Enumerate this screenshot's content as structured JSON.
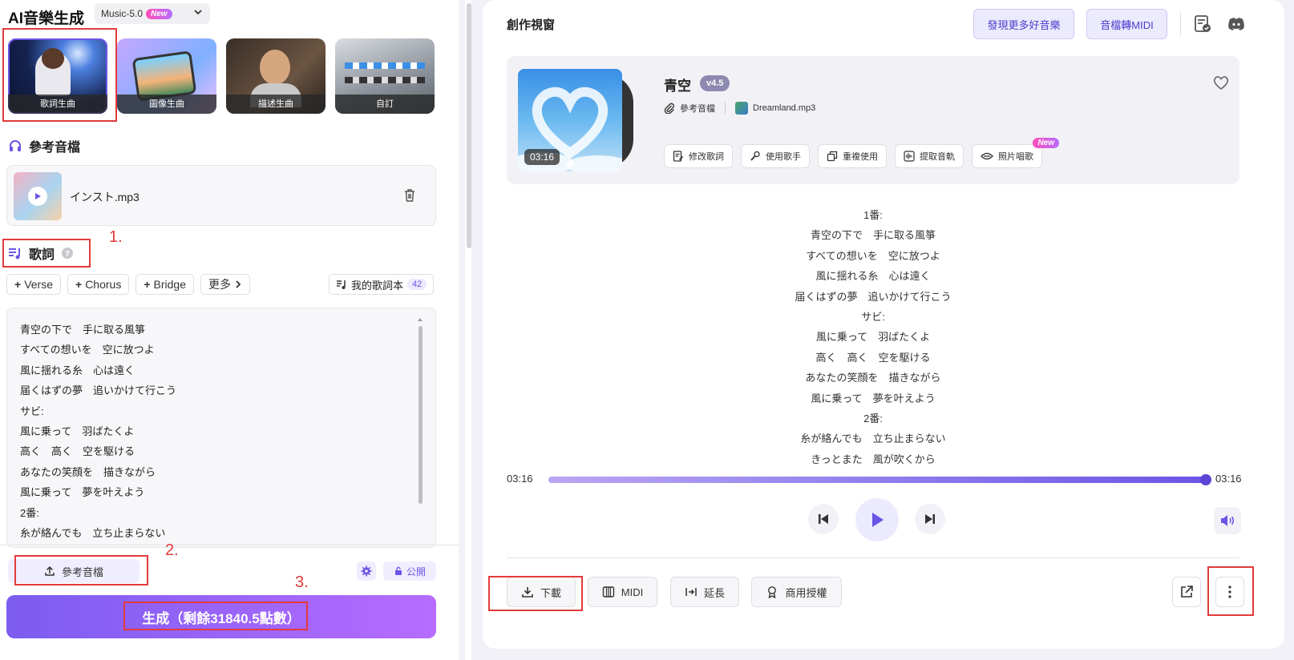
{
  "app": {
    "title": "AI音樂生成",
    "model": "Music-5.0",
    "model_badge": "New"
  },
  "modes": [
    {
      "label": "歌詞生曲",
      "active": true
    },
    {
      "label": "圖像生曲",
      "active": false
    },
    {
      "label": "描述生曲",
      "active": false
    },
    {
      "label": "自訂",
      "active": false
    }
  ],
  "reference": {
    "title": "參考音檔",
    "file_name": "インスト.mp3"
  },
  "lyrics_section": {
    "title": "歌詞",
    "tags": [
      "Verse",
      "Chorus",
      "Bridge"
    ],
    "more_label": "更多",
    "lyric_book_label": "我的歌詞本",
    "lyric_book_count": "42",
    "lines": [
      " 青空の下で　手に取る風箏",
      "すべての想いを　空に放つよ",
      "風に揺れる糸　心は遠く",
      "届くはずの夢　追いかけて行こう",
      "サビ:",
      "風に乗って　羽ばたくよ",
      "高く　高く　空を駆ける",
      "あなたの笑顔を　描きながら",
      "風に乗って　夢を叶えよう",
      "2番:",
      "糸が絡んでも　立ち止まらない"
    ]
  },
  "bottom": {
    "upload_label": "參考音檔",
    "public_label": "公開",
    "generate_label": "生成（剩餘31840.5點數）"
  },
  "annotations": {
    "step1": "1.",
    "step2": "2.",
    "step3": "3."
  },
  "workspace": {
    "title": "創作視窗",
    "discover_label": "發現更多好音樂",
    "midi_convert_label": "音檔轉MIDI"
  },
  "song": {
    "name": "青空",
    "version": "v4.5",
    "duration": "03:16",
    "ref_label": "參考音檔",
    "ref_file": "Dreamland.mp3",
    "actions": [
      {
        "label": "修改歌詞",
        "icon": "edit-lyrics-icon"
      },
      {
        "label": "使用歌手",
        "icon": "microphone-icon"
      },
      {
        "label": "重複使用",
        "icon": "copy-icon"
      },
      {
        "label": "提取音軌",
        "icon": "waveform-icon"
      },
      {
        "label": "照片唱歌",
        "icon": "eye-icon",
        "badge": "New"
      }
    ],
    "lyrics": [
      "1番:",
      "青空の下で　手に取る風箏",
      "すべての想いを　空に放つよ",
      "風に揺れる糸　心は遠く",
      "届くはずの夢　追いかけて行こう",
      "サビ:",
      "風に乗って　羽ばたくよ",
      "高く　高く　空を駆ける",
      "あなたの笑顔を　描きながら",
      "風に乗って　夢を叶えよう",
      "2番:",
      "糸が絡んでも　立ち止まらない",
      "きっとまた　風が吹くから"
    ]
  },
  "player": {
    "current_time": "03:16",
    "total_time": "03:16",
    "progress": 1.0
  },
  "footer_actions": {
    "download_label": "下載",
    "midi_label": "MIDI",
    "extend_label": "延長",
    "license_label": "商用授權"
  },
  "colors": {
    "accent": "#6a55e6",
    "annotation": "#e23b3b"
  }
}
